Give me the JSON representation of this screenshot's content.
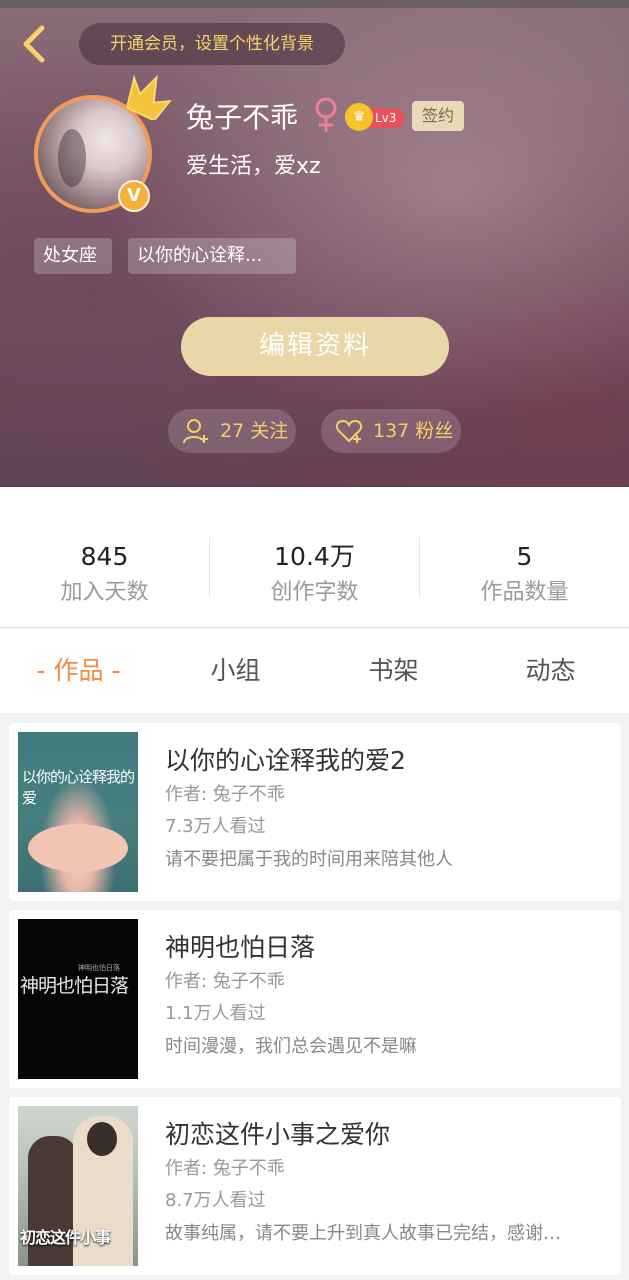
{
  "header": {
    "vip_banner": "开通会员，设置个性化背景",
    "username": "兔子不乖",
    "level": "Lv3",
    "sign_label": "签约",
    "bio": "爱生活，爱xz",
    "tags": [
      "处女座",
      "以你的心诠释..."
    ],
    "edit_button": "编辑资料",
    "follow_label": "27 关注",
    "fans_label": "137 粉丝",
    "verified_badge": "V"
  },
  "stats": [
    {
      "value": "845",
      "label": "加入天数"
    },
    {
      "value": "10.4万",
      "label": "创作字数"
    },
    {
      "value": "5",
      "label": "作品数量"
    }
  ],
  "tabs": [
    "- 作品 -",
    "小组",
    "书架",
    "动态"
  ],
  "works": [
    {
      "title": "以你的心诠释我的爱2",
      "author": "作者: 兔子不乖",
      "views": "7.3万人看过",
      "desc": "请不要把属于我的时间用来陪其他人",
      "cover_text": "以你的心诠释我的爱"
    },
    {
      "title": "神明也怕日落",
      "author": "作者: 兔子不乖",
      "views": "1.1万人看过",
      "desc": "时间漫漫，我们总会遇见不是嘛",
      "cover_text": "神明也怕日落",
      "cover_small": "神明也怕日落"
    },
    {
      "title": "初恋这件小事之爱你",
      "author": "作者: 兔子不乖",
      "views": "8.7万人看过",
      "desc": "故事纯属，请不要上升到真人故事已完结，感谢…",
      "cover_text": "初恋这件小事"
    }
  ],
  "colors": {
    "accent_orange": "#f08c43",
    "gold": "#f4cf6a",
    "edit_button_bg": "#e9d7a8"
  }
}
